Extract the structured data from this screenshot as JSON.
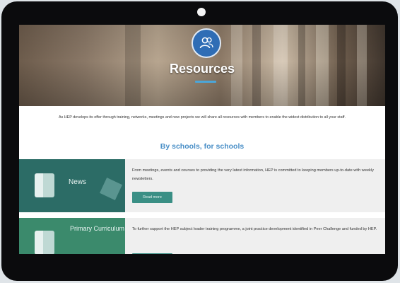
{
  "hero": {
    "title": "Resources",
    "icon": "users-icon"
  },
  "intro_text": "As HEP develops its offer through training, networks, meetings and new projects we will share all resources with members to enable the widest distribution to all your staff.",
  "tagline": "By schools, for schools",
  "cards": [
    {
      "thumb_label": "News",
      "text": "From meetings, events and courses to providing the very latest information, HEP is committed to keeping members up-to-date with weekly newsletters.",
      "button": "Read more"
    },
    {
      "thumb_label": "Primary Curriculum",
      "text": "To further support the HEP subject leader training programme, a joint practice development identified in Peer Challenge and funded by HEP.",
      "button": ""
    }
  ],
  "colors": {
    "accent_blue": "#4a8fc7",
    "icon_circle": "#2f6db5",
    "button_teal": "#3a8f85",
    "bezel": "#0b0b0d"
  }
}
